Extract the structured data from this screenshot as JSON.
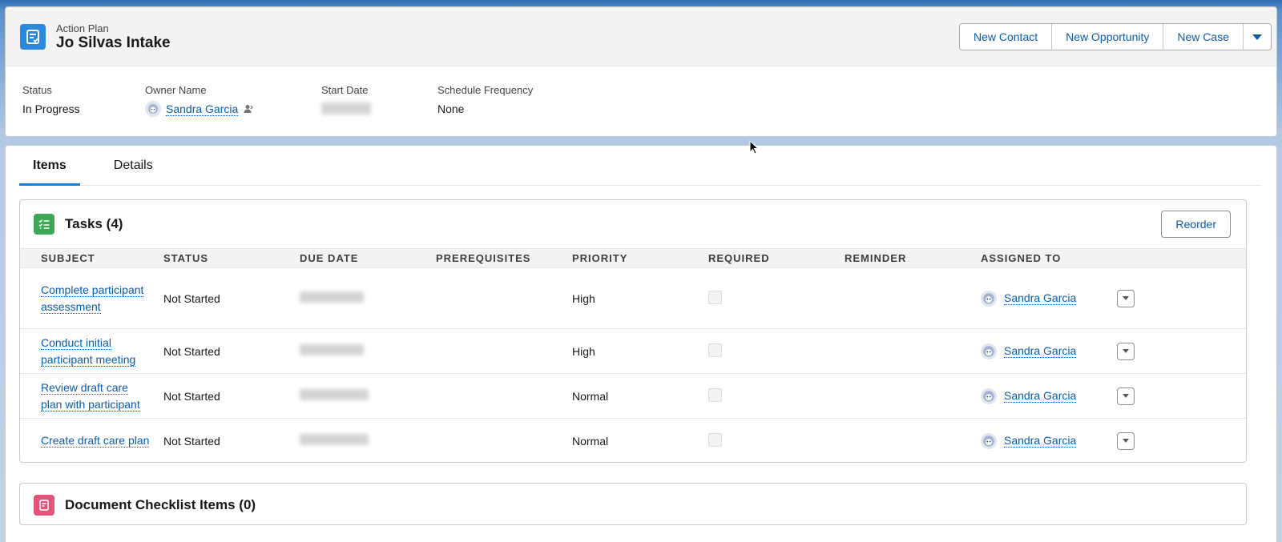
{
  "header": {
    "object_label": "Action Plan",
    "record_title": "Jo Silvas Intake",
    "buttons": {
      "new_contact": "New Contact",
      "new_opportunity": "New Opportunity",
      "new_case": "New Case"
    },
    "icon": "action-plan-icon",
    "accent_color": "#2b8ae0"
  },
  "highlights": {
    "status_label": "Status",
    "status_value": "In Progress",
    "owner_label": "Owner Name",
    "owner_value": "Sandra Garcia",
    "start_date_label": "Start Date",
    "start_date_value": "",
    "frequency_label": "Schedule Frequency",
    "frequency_value": "None"
  },
  "tabs": [
    {
      "label": "Items",
      "active": true
    },
    {
      "label": "Details",
      "active": false
    }
  ],
  "tasks": {
    "title": "Tasks (4)",
    "reorder_label": "Reorder",
    "icon": "task-list-icon",
    "icon_color": "#3ba755",
    "columns": {
      "subject": "SUBJECT",
      "status": "STATUS",
      "due_date": "DUE DATE",
      "prerequisites": "PREREQUISITES",
      "priority": "PRIORITY",
      "required": "REQUIRED",
      "reminder": "REMINDER",
      "assigned_to": "ASSIGNED TO"
    },
    "rows": [
      {
        "subject": "Complete participant assessment",
        "status": "Not Started",
        "due_date": "",
        "prerequisites": "",
        "priority": "High",
        "required": false,
        "reminder": "",
        "assigned_to": "Sandra Garcia"
      },
      {
        "subject": "Conduct initial participant meeting",
        "status": "Not Started",
        "due_date": "",
        "prerequisites": "",
        "priority": "High",
        "required": false,
        "reminder": "",
        "assigned_to": "Sandra Garcia"
      },
      {
        "subject": "Review draft care plan with participant",
        "status": "Not Started",
        "due_date": "",
        "prerequisites": "",
        "priority": "Normal",
        "required": false,
        "reminder": "",
        "assigned_to": "Sandra Garcia"
      },
      {
        "subject": "Create draft care plan",
        "status": "Not Started",
        "due_date": "",
        "prerequisites": "",
        "priority": "Normal",
        "required": false,
        "reminder": "",
        "assigned_to": "Sandra Garcia"
      }
    ]
  },
  "documents": {
    "title": "Document Checklist Items (0)",
    "icon": "document-checklist-icon",
    "icon_color": "#e3547a"
  }
}
